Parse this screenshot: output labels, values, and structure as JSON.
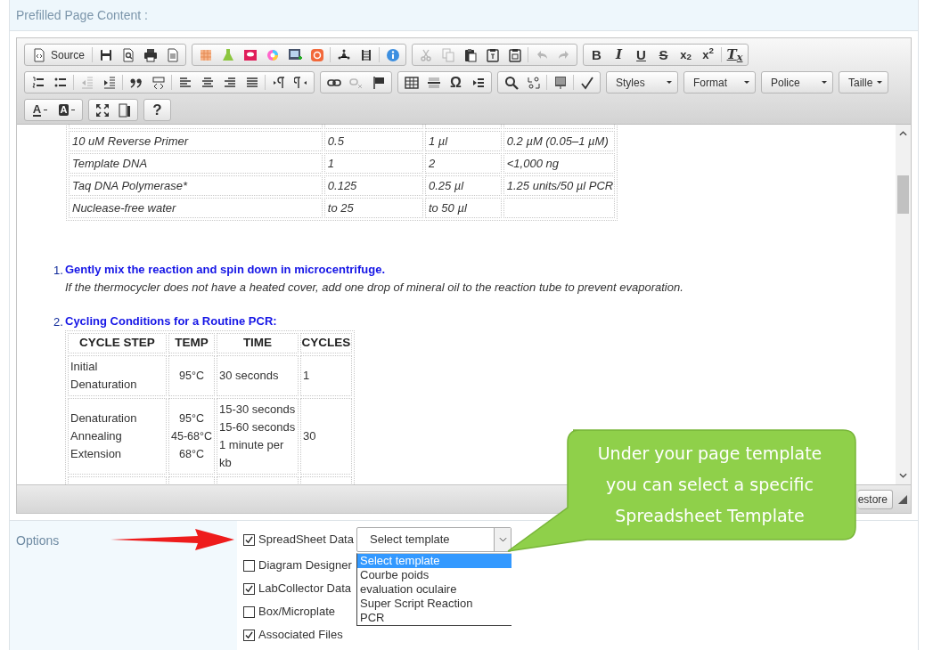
{
  "section_title": "Prefilled Page Content :",
  "editor": {
    "toolbar": [
      [
        {
          "kind": "group",
          "items": [
            {
              "kind": "labeled",
              "label": "Source",
              "disabled": false
            },
            {
              "kind": "separator"
            },
            {
              "kind": "icon",
              "disabled": false
            },
            {
              "kind": "icon",
              "disabled": false
            },
            {
              "kind": "icon",
              "disabled": false
            },
            {
              "kind": "icon",
              "disabled": false
            }
          ]
        },
        {
          "kind": "group",
          "items": [
            {
              "kind": "icon",
              "disabled": false
            },
            {
              "kind": "icon",
              "disabled": false
            },
            {
              "kind": "icon",
              "disabled": false
            },
            {
              "kind": "icon",
              "disabled": false
            },
            {
              "kind": "icon",
              "disabled": false
            },
            {
              "kind": "icon",
              "disabled": false
            },
            {
              "kind": "separator"
            },
            {
              "kind": "icon",
              "disabled": false
            },
            {
              "kind": "icon",
              "disabled": false
            },
            {
              "kind": "separator"
            },
            {
              "kind": "icon",
              "disabled": false
            }
          ]
        },
        {
          "kind": "group",
          "items": [
            {
              "kind": "icon",
              "disabled": true
            },
            {
              "kind": "icon",
              "disabled": true
            },
            {
              "kind": "icon",
              "disabled": false
            },
            {
              "kind": "icon",
              "disabled": false
            },
            {
              "kind": "icon",
              "disabled": false
            },
            {
              "kind": "separator"
            },
            {
              "kind": "icon",
              "disabled": true
            },
            {
              "kind": "icon",
              "disabled": true
            }
          ]
        },
        {
          "kind": "group",
          "items": [
            {
              "kind": "glyph",
              "label": "B",
              "disabled": false
            },
            {
              "kind": "glyph",
              "label": "I",
              "disabled": false
            },
            {
              "kind": "glyph",
              "label": "U",
              "disabled": false
            },
            {
              "kind": "glyph",
              "label": "S",
              "disabled": false
            },
            {
              "kind": "glyph",
              "label": "x$_{2}$",
              "disabled": false
            },
            {
              "kind": "glyph",
              "label": "x$^{2}$",
              "disabled": false
            },
            {
              "kind": "separator"
            },
            {
              "kind": "glyph",
              "label": "T$_{x}$",
              "disabled": false
            }
          ]
        }
      ],
      [
        {
          "kind": "group",
          "items": [
            {
              "kind": "icon",
              "disabled": false
            },
            {
              "kind": "icon",
              "disabled": false
            },
            {
              "kind": "separator"
            },
            {
              "kind": "icon",
              "disabled": true
            },
            {
              "kind": "icon",
              "disabled": false
            },
            {
              "kind": "separator"
            },
            {
              "kind": "icon",
              "disabled": false
            },
            {
              "kind": "icon",
              "disabled": false
            },
            {
              "kind": "separator"
            },
            {
              "kind": "icon",
              "disabled": false
            },
            {
              "kind": "icon",
              "disabled": false
            },
            {
              "kind": "icon",
              "disabled": false
            },
            {
              "kind": "icon",
              "disabled": false
            },
            {
              "kind": "separator"
            },
            {
              "kind": "icon",
              "disabled": false
            },
            {
              "kind": "icon",
              "disabled": false
            }
          ]
        },
        {
          "kind": "group",
          "items": [
            {
              "kind": "icon",
              "disabled": false
            },
            {
              "kind": "icon",
              "disabled": true
            },
            {
              "kind": "icon",
              "disabled": false
            }
          ]
        },
        {
          "kind": "group",
          "items": [
            {
              "kind": "icon",
              "disabled": false
            },
            {
              "kind": "icon",
              "disabled": false
            },
            {
              "kind": "glyph",
              "label": "Ω",
              "disabled": false
            },
            {
              "kind": "icon",
              "disabled": false
            }
          ]
        },
        {
          "kind": "group",
          "items": [
            {
              "kind": "icon",
              "disabled": false
            },
            {
              "kind": "icon",
              "disabled": false
            },
            {
              "kind": "separator"
            },
            {
              "kind": "icon",
              "disabled": false
            },
            {
              "kind": "separator"
            },
            {
              "kind": "icon",
              "disabled": false
            }
          ]
        },
        {
          "kind": "combo",
          "label": "Styles"
        },
        {
          "kind": "combo",
          "label": "Format"
        },
        {
          "kind": "combo",
          "label": "Police"
        },
        {
          "kind": "combo",
          "label": "Taille"
        }
      ],
      [
        {
          "kind": "group",
          "items": [
            {
              "kind": "color_menu",
              "label": "A",
              "disabled": false
            },
            {
              "kind": "color_menu",
              "label": "A",
              "disabled": false
            }
          ]
        },
        {
          "kind": "group",
          "items": [
            {
              "kind": "icon",
              "disabled": false
            },
            {
              "kind": "icon",
              "disabled": false
            }
          ]
        },
        {
          "kind": "group",
          "items": [
            {
              "kind": "glyph",
              "label": "?",
              "disabled": false
            }
          ]
        }
      ]
    ],
    "content": {
      "reagent_table": {
        "rows": [
          [
            "10 uM Reverse Primer",
            "0.5",
            "1 µl",
            "0.2 µM (0.05–1 µM)"
          ],
          [
            "Template DNA",
            "1",
            "2",
            "<1,000 ng"
          ],
          [
            "Taq DNA Polymerase*",
            "0.125",
            "0.25 µl",
            "1.25 units/50 µl PCR"
          ],
          [
            "Nuclease-free water",
            "to 25",
            "to 50 µl",
            ""
          ]
        ]
      },
      "steps": [
        {
          "number": "1.",
          "title": "Gently mix the reaction and spin down in microcentrifuge.",
          "note": "If the thermocycler does not have a heated cover, add one drop of mineral oil to the reaction tube to prevent evaporation."
        },
        {
          "number": "2.",
          "title": "Cycling Conditions for a Routine PCR:",
          "table": {
            "columns": [
              "CYCLE STEP",
              "TEMP",
              "TIME",
              "CYCLES"
            ],
            "rows": [
              [
                [
                  "Initial Denaturation"
                ],
                [
                  "95°C"
                ],
                [
                  "30 seconds"
                ],
                [
                  "1"
                ]
              ],
              [
                [
                  "Denaturation",
                  "Annealing",
                  "Extension"
                ],
                [
                  "95°C",
                  "45-68°C",
                  "68°C"
                ],
                [
                  "15-30 seconds",
                  "15-60 seconds",
                  "1 minute per kb"
                ],
                [
                  "30"
                ]
              ]
            ]
          }
        }
      ]
    },
    "status_bar": {
      "button": "estore"
    }
  },
  "callout": {
    "lines": [
      "Under your page template",
      "you can select a specific",
      "Spreadsheet Template"
    ]
  },
  "options": {
    "label": "Options",
    "checkboxes": [
      {
        "label": "SpreadSheet Data",
        "checked": true
      },
      {
        "label": "Diagram Designer",
        "checked": false
      },
      {
        "label": "LabCollector Data",
        "checked": true
      },
      {
        "label": "Box/Microplate",
        "checked": false
      },
      {
        "label": "Associated Files",
        "checked": true
      }
    ],
    "template_select": {
      "value": "Select template",
      "options": [
        {
          "label": "Select template",
          "selected": true
        },
        {
          "label": "Courbe poids",
          "selected": false
        },
        {
          "label": "evaluation oculaire",
          "selected": false
        },
        {
          "label": "Super Script Reaction",
          "selected": false
        },
        {
          "label": "PCR",
          "selected": false
        }
      ]
    }
  }
}
